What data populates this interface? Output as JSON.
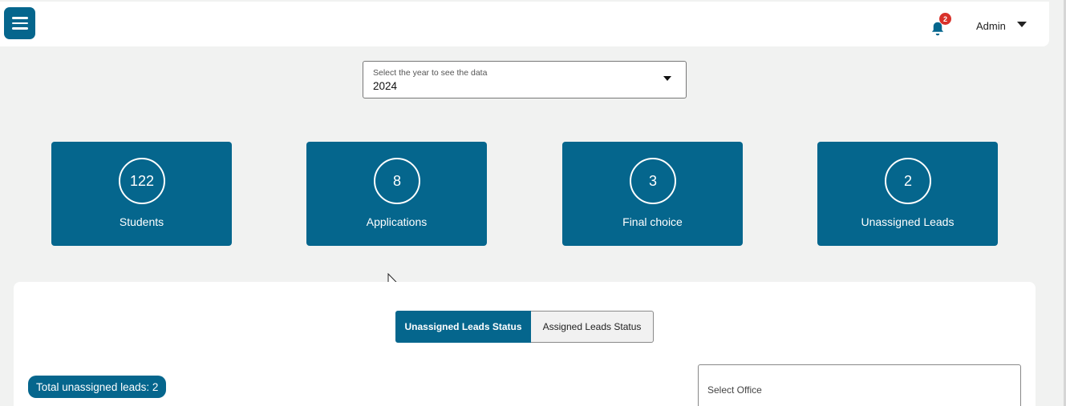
{
  "header": {
    "menu_icon": "hamburger-icon",
    "notifications": {
      "icon": "bell-icon",
      "count": "2"
    },
    "user": {
      "name": "Admin",
      "caret_icon": "caret-down-icon"
    }
  },
  "year_select": {
    "label": "Select the year to see the data",
    "value": "2024"
  },
  "stats": [
    {
      "value": "122",
      "label": "Students"
    },
    {
      "value": "8",
      "label": "Applications"
    },
    {
      "value": "3",
      "label": "Final choice"
    },
    {
      "value": "2",
      "label": "Unassigned Leads"
    }
  ],
  "panel": {
    "tabs": [
      {
        "label": "Unassigned Leads Status",
        "active": true
      },
      {
        "label": "Assigned Leads Status",
        "active": false
      }
    ],
    "total_label": "Total unassigned leads: 2",
    "office_select": {
      "placeholder": "Select Office"
    }
  },
  "colors": {
    "primary": "#05668d",
    "background": "#f1f2f1",
    "badge": "#d8312a"
  }
}
